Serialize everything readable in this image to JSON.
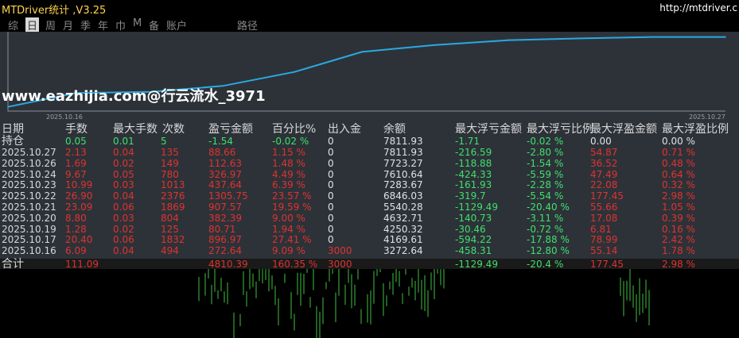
{
  "app": {
    "title": "MTDriver统计 ,V3.25",
    "url": "http://mtdriver.c"
  },
  "tabs": [
    {
      "label": "综",
      "active": false
    },
    {
      "label": "日",
      "active": true
    },
    {
      "label": "周",
      "active": false
    },
    {
      "label": "月",
      "active": false
    },
    {
      "label": "季",
      "active": false
    },
    {
      "label": "年",
      "active": false
    },
    {
      "label": "巾",
      "active": false
    },
    {
      "label": "M",
      "active": false
    },
    {
      "label": "备",
      "active": false
    },
    {
      "label": "账户",
      "active": false
    },
    {
      "label": "路径",
      "active": false
    }
  ],
  "equity_chart": {
    "start_label": "2025.10.16",
    "end_label": "2025.10.27",
    "line_color": "#2aa9e0",
    "points": [
      3272.64,
      4169.61,
      4250.32,
      4632.71,
      5540.28,
      6846.03,
      7283.67,
      7610.64,
      7723.27,
      7811.93,
      7811.93
    ]
  },
  "watermark": "www.eazhijia.com@行云流水_3971",
  "table": {
    "headers": [
      "日期",
      "手数",
      "最大手数",
      "次数",
      "盈亏金额",
      "百分比%",
      "出入金",
      "余额",
      "最大浮亏金额",
      "最大浮亏比例",
      "最大浮盈金额",
      "最大浮盈比例"
    ],
    "holding": {
      "label": "持仓",
      "cells": [
        "0.05",
        "0.01",
        "5",
        "-1.54",
        "-0.02 %",
        "0",
        "7811.93",
        "-1.71",
        "-0.02 %",
        "0.00",
        "0.00 %"
      ]
    },
    "rows": [
      {
        "date": "2025.10.27",
        "lots": "2.13",
        "max_lots": "0.04",
        "count": "135",
        "pnl": "88.66",
        "pct": "1.15 %",
        "flow": "0",
        "balance": "7811.93",
        "max_float_loss": "-216.59",
        "max_float_loss_pct": "-2.80 %",
        "max_float_profit": "54.87",
        "max_float_profit_pct": "0.71 %"
      },
      {
        "date": "2025.10.26",
        "lots": "1.69",
        "max_lots": "0.02",
        "count": "149",
        "pnl": "112.63",
        "pct": "1.48 %",
        "flow": "0",
        "balance": "7723.27",
        "max_float_loss": "-118.88",
        "max_float_loss_pct": "-1.54 %",
        "max_float_profit": "36.52",
        "max_float_profit_pct": "0.48 %"
      },
      {
        "date": "2025.10.24",
        "lots": "9.67",
        "max_lots": "0.05",
        "count": "780",
        "pnl": "326.97",
        "pct": "4.49 %",
        "flow": "0",
        "balance": "7610.64",
        "max_float_loss": "-424.33",
        "max_float_loss_pct": "-5.59 %",
        "max_float_profit": "47.49",
        "max_float_profit_pct": "0.64 %"
      },
      {
        "date": "2025.10.23",
        "lots": "10.99",
        "max_lots": "0.03",
        "count": "1013",
        "pnl": "437.64",
        "pct": "6.39 %",
        "flow": "0",
        "balance": "7283.67",
        "max_float_loss": "-161.93",
        "max_float_loss_pct": "-2.28 %",
        "max_float_profit": "22.08",
        "max_float_profit_pct": "0.32 %"
      },
      {
        "date": "2025.10.22",
        "lots": "26.90",
        "max_lots": "0.04",
        "count": "2376",
        "pnl": "1305.75",
        "pct": "23.57 %",
        "flow": "0",
        "balance": "6846.03",
        "max_float_loss": "-319.7",
        "max_float_loss_pct": "-5.54 %",
        "max_float_profit": "177.45",
        "max_float_profit_pct": "2.98 %"
      },
      {
        "date": "2025.10.21",
        "lots": "23.09",
        "max_lots": "0.06",
        "count": "1869",
        "pnl": "907.57",
        "pct": "19.59 %",
        "flow": "0",
        "balance": "5540.28",
        "max_float_loss": "-1129.49",
        "max_float_loss_pct": "-20.40 %",
        "max_float_profit": "55.66",
        "max_float_profit_pct": "1.05 %"
      },
      {
        "date": "2025.10.20",
        "lots": "8.80",
        "max_lots": "0.03",
        "count": "804",
        "pnl": "382.39",
        "pct": "9.00 %",
        "flow": "0",
        "balance": "4632.71",
        "max_float_loss": "-140.73",
        "max_float_loss_pct": "-3.11 %",
        "max_float_profit": "17.08",
        "max_float_profit_pct": "0.39 %"
      },
      {
        "date": "2025.10.19",
        "lots": "1.28",
        "max_lots": "0.02",
        "count": "125",
        "pnl": "80.71",
        "pct": "1.94 %",
        "flow": "0",
        "balance": "4250.32",
        "max_float_loss": "-30.46",
        "max_float_loss_pct": "-0.72 %",
        "max_float_profit": "6.81",
        "max_float_profit_pct": "0.16 %"
      },
      {
        "date": "2025.10.17",
        "lots": "20.40",
        "max_lots": "0.06",
        "count": "1832",
        "pnl": "896.97",
        "pct": "27.41 %",
        "flow": "0",
        "balance": "4169.61",
        "max_float_loss": "-594.22",
        "max_float_loss_pct": "-17.88 %",
        "max_float_profit": "78.99",
        "max_float_profit_pct": "2.42 %"
      },
      {
        "date": "2025.10.16",
        "lots": "6.09",
        "max_lots": "0.04",
        "count": "494",
        "pnl": "272.64",
        "pct": "9.09 %",
        "flow": "3000",
        "balance": "3272.64",
        "max_float_loss": "-458.31",
        "max_float_loss_pct": "-12.80 %",
        "max_float_profit": "55.14",
        "max_float_profit_pct": "1.78 %"
      }
    ],
    "total": {
      "label": "合计",
      "lots": "111.09",
      "pnl": "4810.39",
      "pct": "160.35 %",
      "flow": "3000",
      "max_float_loss": "-1129.49",
      "max_float_loss_pct": "-20.4 %",
      "max_float_profit": "177.45",
      "max_float_profit_pct": "2.98 %"
    }
  },
  "colors": {
    "red": "#e0322d",
    "green": "#3fe06a",
    "white": "#e0e0e0",
    "header": "#d8d8d8",
    "title": "#ffd54a"
  }
}
